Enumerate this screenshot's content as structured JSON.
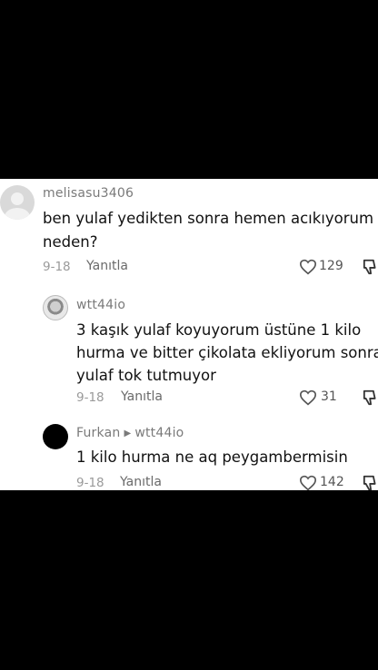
{
  "comments": [
    {
      "username": "melisasu3406",
      "lines": [
        "ben yulaf yedikten sonra hemen acıkıyorum",
        "neden?"
      ],
      "date": "9-18",
      "reply_label": "Yanıtla",
      "likes": "129"
    },
    {
      "username": "wtt44io",
      "lines": [
        "3 kaşık yulaf koyuyorum üstüne 1 kilo",
        "hurma ve bitter çikolata ekliyorum sonra",
        "yulaf tok tutmuyor"
      ],
      "date": "9-18",
      "reply_label": "Yanıtla",
      "likes": "31"
    },
    {
      "username": "Furkan",
      "reply_to": "wtt44io",
      "lines": [
        "1 kilo hurma ne aq peygambermisin"
      ],
      "date": "9-18",
      "reply_label": "Yanıtla",
      "likes": "142"
    }
  ],
  "icons": {
    "like": "heart-outline-icon",
    "dislike": "thumbs-down-icon",
    "reply_arrow": "triangle-right-icon"
  }
}
